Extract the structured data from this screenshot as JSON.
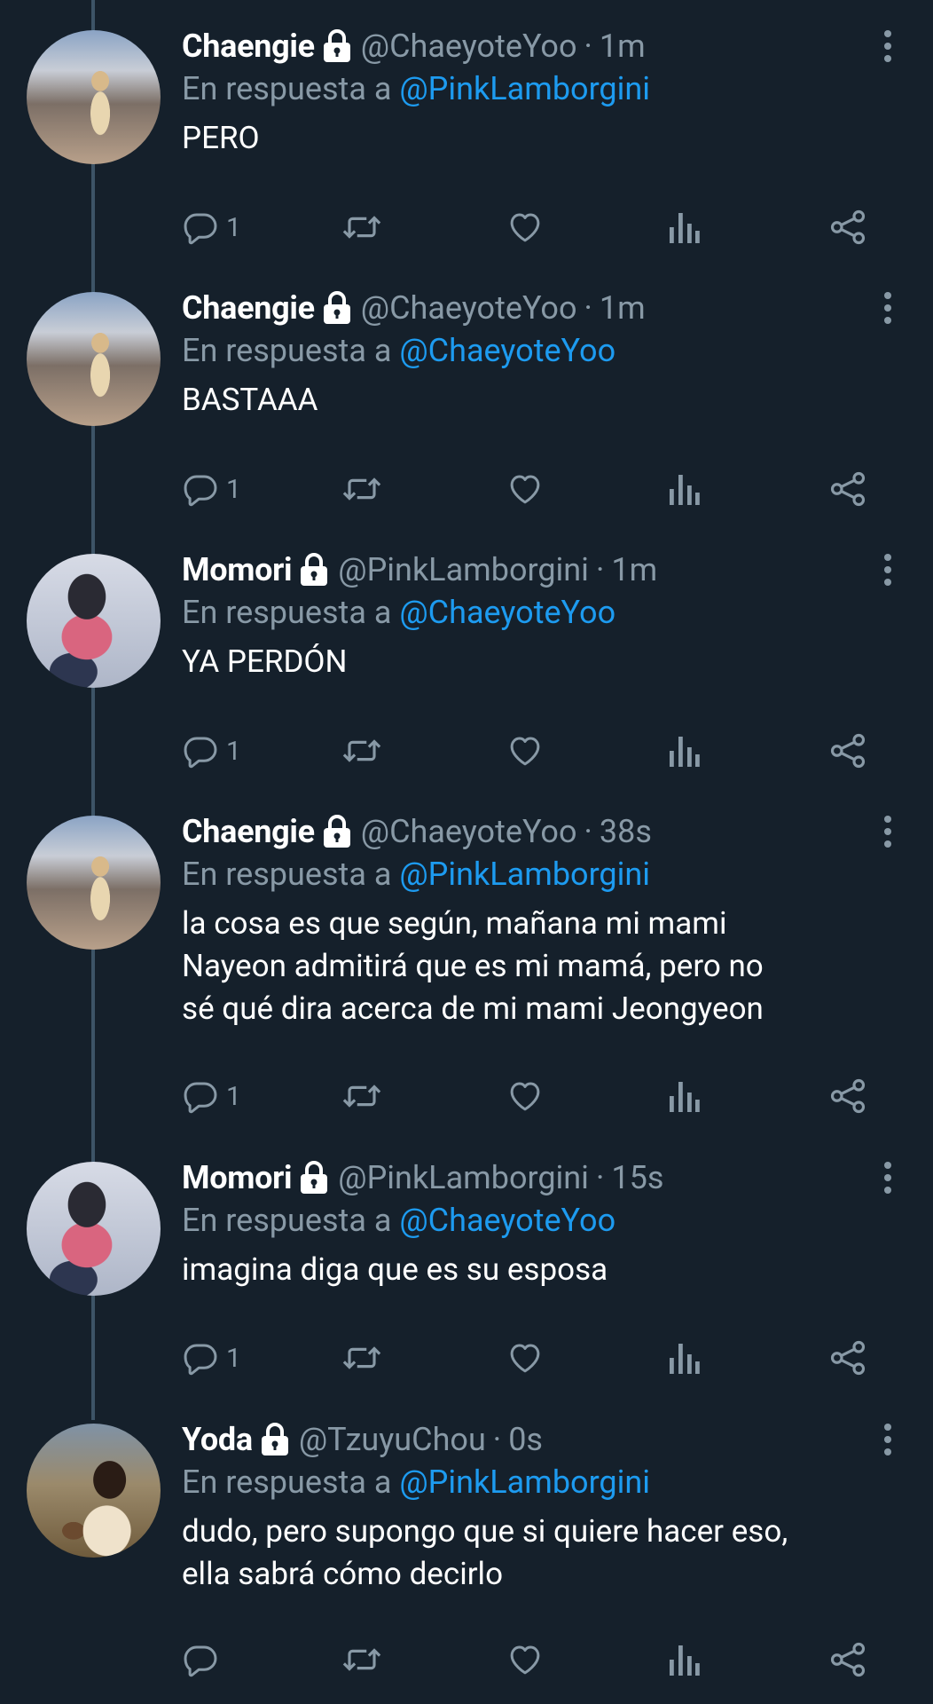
{
  "reply_prefix": "En respuesta a",
  "separator": "·",
  "tweets": [
    {
      "name": "Chaengie",
      "handle": "@ChaeyoteYoo",
      "time": "1m",
      "reply_to": "@PinkLamborgini",
      "text": "PERO",
      "reply_count": "1",
      "avatar": "chaengie"
    },
    {
      "name": "Chaengie",
      "handle": "@ChaeyoteYoo",
      "time": "1m",
      "reply_to": "@ChaeyoteYoo",
      "text": "BASTAAA",
      "reply_count": "1",
      "avatar": "chaengie"
    },
    {
      "name": "Momori",
      "handle": "@PinkLamborgini",
      "time": "1m",
      "reply_to": "@ChaeyoteYoo",
      "text": "YA PERDÓN",
      "reply_count": "1",
      "avatar": "momori"
    },
    {
      "name": "Chaengie",
      "handle": "@ChaeyoteYoo",
      "time": "38s",
      "reply_to": "@PinkLamborgini",
      "text_lines": [
        "la cosa es que según, mañana mi mami",
        "Nayeon admitirá que es mi mamá, pero no",
        "sé qué dira acerca de mi mami Jeongyeon"
      ],
      "reply_count": "1",
      "avatar": "chaengie"
    },
    {
      "name": "Momori",
      "handle": "@PinkLamborgini",
      "time": "15s",
      "reply_to": "@ChaeyoteYoo",
      "text": "imagina diga que es su esposa",
      "reply_count": "1",
      "avatar": "momori"
    },
    {
      "name": "Yoda",
      "handle": "@TzuyuChou",
      "time": "0s",
      "reply_to": "@PinkLamborgini",
      "text_lines": [
        "dudo, pero supongo que si quiere hacer eso,",
        "ella sabrá cómo decirlo"
      ],
      "reply_count": "",
      "avatar": "yoda"
    }
  ],
  "icons": {
    "lock": "lock-icon",
    "more": "more-vertical-icon",
    "reply": "reply-icon",
    "retweet": "retweet-icon",
    "like": "heart-icon",
    "analytics": "analytics-icon",
    "share": "share-icon"
  },
  "colors": {
    "background": "#15202b",
    "mention": "#1d9bf0",
    "muted": "#8899a6",
    "thread_line": "#3d5466"
  }
}
